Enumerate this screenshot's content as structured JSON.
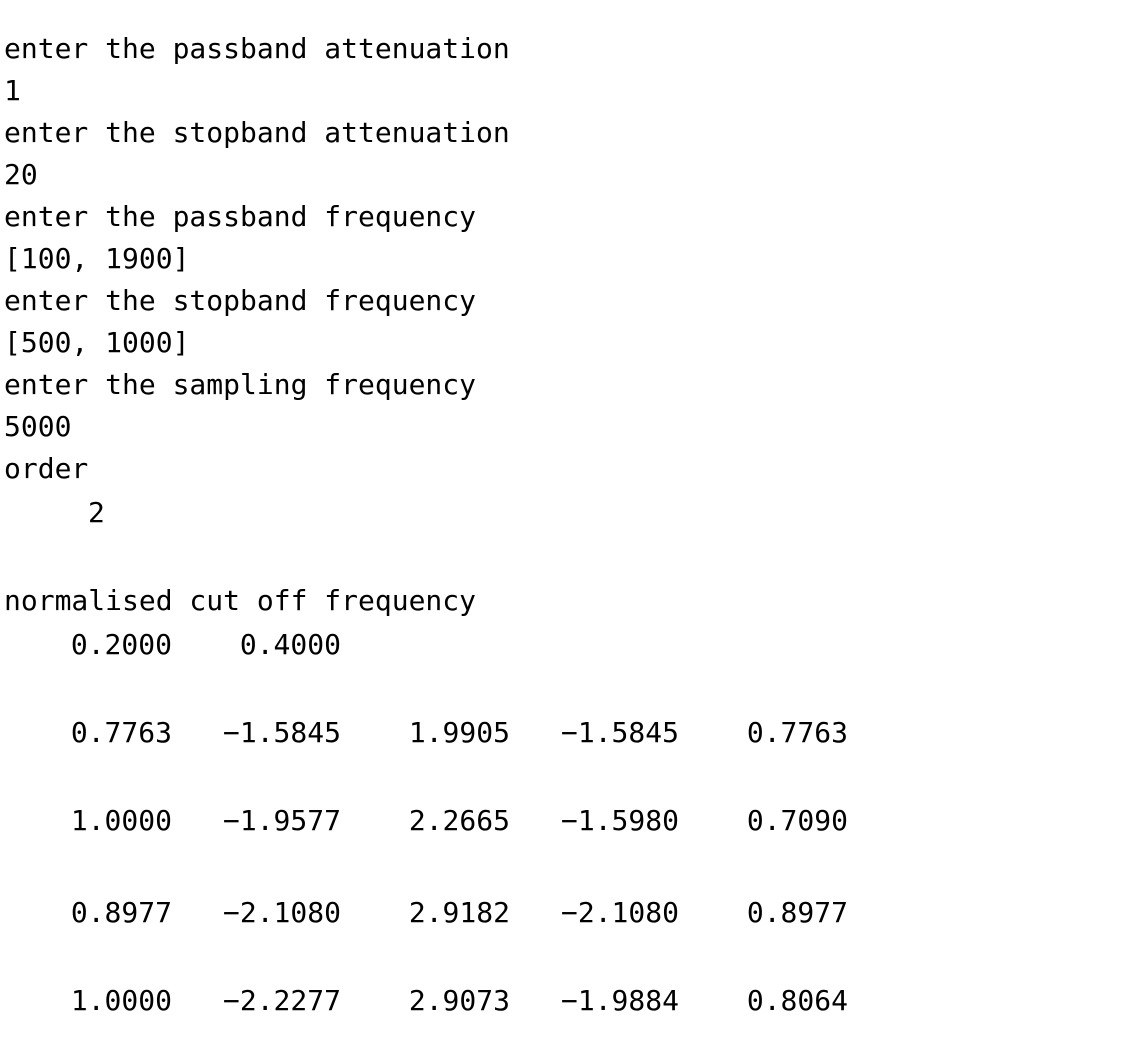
{
  "console": {
    "prompt_passband_attenuation": "enter the passband attenuation",
    "value_passband_attenuation": "1",
    "prompt_stopband_attenuation": "enter the stopband attenuation",
    "value_stopband_attenuation": "20",
    "prompt_passband_frequency": "enter the passband frequency",
    "value_passband_frequency": "[100, 1900]",
    "prompt_stopband_frequency": "enter the stopband frequency",
    "value_stopband_frequency": "[500, 1000]",
    "prompt_sampling_frequency": "enter the sampling frequency",
    "value_sampling_frequency": "5000",
    "order_label": "order",
    "order_value": "2",
    "cutoff_label": "normalised cut off frequency",
    "cutoff_values": [
      "0.2000",
      "0.4000"
    ],
    "matrix_rows": [
      [
        "0.7763",
        "−1.5845",
        "1.9905",
        "−1.5845",
        "0.7763"
      ],
      [
        "1.0000",
        "−1.9577",
        "2.2665",
        "−1.5980",
        "0.7090"
      ],
      [
        "0.8977",
        "−2.1080",
        "2.9182",
        "−2.1080",
        "0.8977"
      ],
      [
        "1.0000",
        "−2.2277",
        "2.9073",
        "−1.9884",
        "0.8064"
      ]
    ]
  }
}
